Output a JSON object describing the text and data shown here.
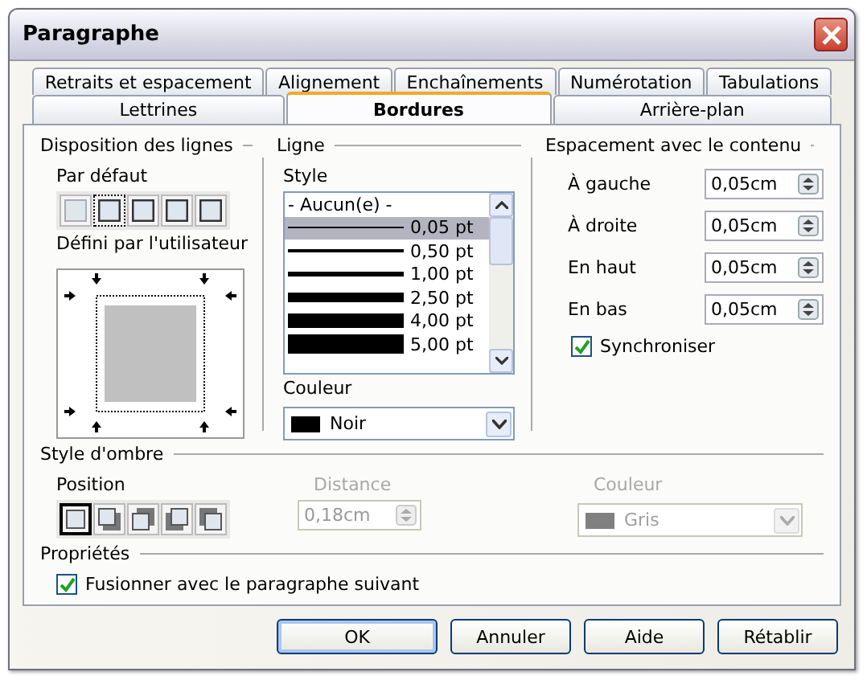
{
  "window": {
    "title": "Paragraphe"
  },
  "tabs_back": [
    {
      "label": "Retraits et espacement",
      "selected": false
    },
    {
      "label": "Alignement",
      "selected": false
    },
    {
      "label": "Enchaînements",
      "selected": false
    },
    {
      "label": "Numérotation",
      "selected": false
    },
    {
      "label": "Tabulations",
      "selected": false
    }
  ],
  "tabs_front": [
    {
      "label": "Lettrines",
      "selected": false
    },
    {
      "label": "Bordures",
      "selected": true
    },
    {
      "label": "Arrière-plan",
      "selected": false
    }
  ],
  "line_arrangement": {
    "title": "Disposition des lignes",
    "default_label": "Par défaut",
    "presets": [
      {
        "selected": false
      },
      {
        "selected": true
      },
      {
        "selected": false
      },
      {
        "selected": false
      },
      {
        "selected": false
      }
    ],
    "user_label": "Défini par l'utilisateur"
  },
  "line": {
    "title": "Ligne",
    "style_label": "Style",
    "styles": [
      {
        "label": "- Aucun(e) -",
        "kind": "none",
        "selected": false
      },
      {
        "label": "0,05 pt",
        "kind": "line",
        "selected": true
      },
      {
        "label": "0,50 pt",
        "kind": "line",
        "selected": false
      },
      {
        "label": "1,00 pt",
        "kind": "line",
        "selected": false
      },
      {
        "label": "2,50 pt",
        "kind": "line",
        "selected": false
      },
      {
        "label": "4,00 pt",
        "kind": "line",
        "selected": false
      },
      {
        "label": "5,00 pt",
        "kind": "line",
        "selected": false
      }
    ],
    "color_label": "Couleur",
    "color": {
      "name": "Noir",
      "color": "#000000"
    }
  },
  "spacing": {
    "title": "Espacement avec le contenu",
    "fields": [
      {
        "label": "À gauche",
        "value": "0,05cm"
      },
      {
        "label": "À droite",
        "value": "0,05cm"
      },
      {
        "label": "En haut",
        "value": "0,05cm"
      },
      {
        "label": "En bas",
        "value": "0,05cm"
      }
    ],
    "sync": {
      "label": "Synchroniser",
      "checked": true
    }
  },
  "shadow": {
    "title": "Style d'ombre",
    "position_label": "Position",
    "positions": [
      {
        "selected": true
      },
      {
        "selected": false
      },
      {
        "selected": false
      },
      {
        "selected": false
      },
      {
        "selected": false
      }
    ],
    "distance_label": "Distance",
    "distance": {
      "value": "0,18cm",
      "disabled": true
    },
    "color_label": "Couleur",
    "color": {
      "name": "Gris",
      "color": "#808080",
      "disabled": true
    }
  },
  "properties": {
    "title": "Propriétés",
    "merge": {
      "label": "Fusionner avec le paragraphe suivant",
      "checked": true
    }
  },
  "buttons": [
    {
      "label": "OK",
      "kind": "default"
    },
    {
      "label": "Annuler",
      "kind": "normal"
    },
    {
      "label": "Aide",
      "kind": "normal"
    },
    {
      "label": "Rétablir",
      "kind": "normal"
    }
  ]
}
